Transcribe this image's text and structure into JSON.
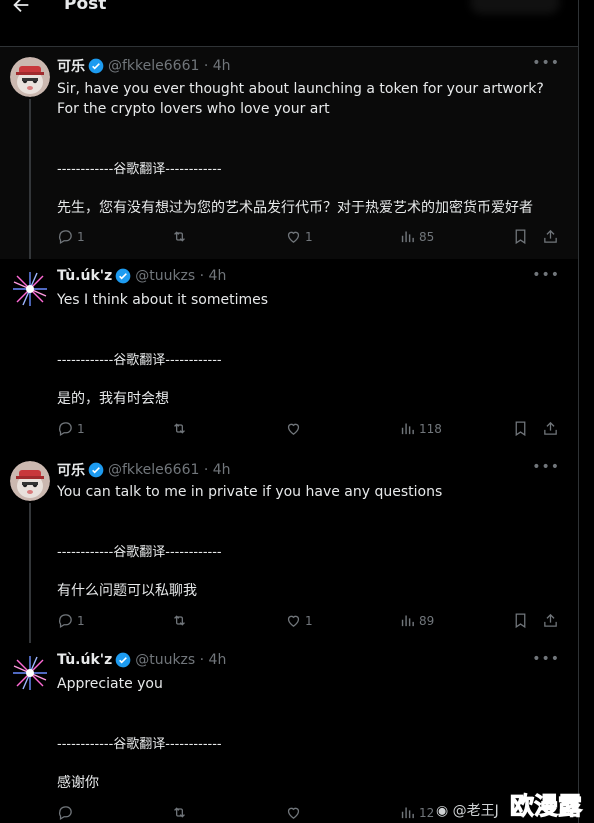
{
  "header": {
    "title": "Post"
  },
  "divider": "------------谷歌翻译------------",
  "tweets": [
    {
      "name": "可乐",
      "handle": "@fkkele6661 · 4h",
      "text": "Sir, have you ever thought about launching a token for your artwork? For the crypto lovers who love your art",
      "translation": "先生，您有没有想过为您的艺术品发行代币？对于热爱艺术的加密货币爱好者",
      "replies": "1",
      "retweets": "",
      "likes": "1",
      "views": "85"
    },
    {
      "name": "Tù.úk'z",
      "handle": "@tuukzs · 4h",
      "text": "Yes I think about it sometimes",
      "translation": "是的，我有时会想",
      "replies": "1",
      "retweets": "",
      "likes": "",
      "views": "118"
    },
    {
      "name": "可乐",
      "handle": "@fkkele6661 · 4h",
      "text": "You can talk to me in private if you have any questions",
      "translation": "有什么问题可以私聊我",
      "replies": "1",
      "retweets": "",
      "likes": "1",
      "views": "89"
    },
    {
      "name": "Tù.úk'z",
      "handle": "@tuukzs · 4h",
      "text": "Appreciate you",
      "translation": "感谢你",
      "replies": "",
      "retweets": "",
      "likes": "",
      "views": "12"
    }
  ],
  "watermark": {
    "weibo": "@老王J",
    "logo": "欧漫露"
  },
  "colors": {
    "background": "#000000",
    "text": "#e7e9ea",
    "muted": "#71767b",
    "verified": "#1d9bf0",
    "divider": "#2f3336"
  }
}
